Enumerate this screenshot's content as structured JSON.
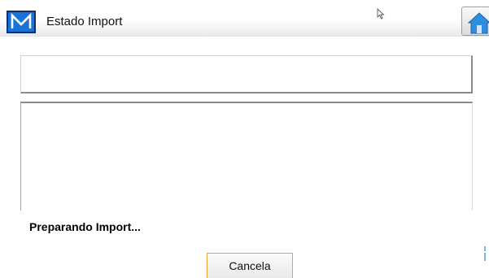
{
  "window": {
    "title": "Estado Import",
    "logo_icon": "m-logo-icon",
    "home_icon": "home-icon"
  },
  "main": {
    "status_text": "Preparando Import...",
    "cancel_label": "Cancela"
  },
  "colors": {
    "logo_blue": "#1a73d6",
    "logo_border": "#0b2f72",
    "home_blue": "#2e8fe0",
    "cancel_border": "#e8a33d"
  }
}
